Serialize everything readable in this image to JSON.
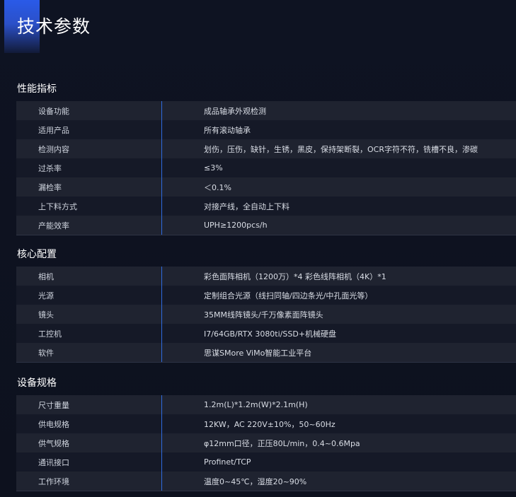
{
  "page_title": "技术参数",
  "sections": [
    {
      "title": "性能指标",
      "rows": [
        {
          "label": "设备功能",
          "value": "成品轴承外观检测"
        },
        {
          "label": "适用产品",
          "value": "所有滚动轴承"
        },
        {
          "label": "检测内容",
          "value": "划伤，压伤，缺针，生锈，黑皮，保持架断裂，OCR字符不符，铣槽不良，渗碳"
        },
        {
          "label": "过杀率",
          "value": "≤3%"
        },
        {
          "label": "漏检率",
          "value": "＜0.1%"
        },
        {
          "label": "上下料方式",
          "value": "对接产线，全自动上下料"
        },
        {
          "label": "产能效率",
          "value": "UPH≥1200pcs/h"
        }
      ]
    },
    {
      "title": "核心配置",
      "rows": [
        {
          "label": "相机",
          "value": "彩色面阵相机（1200万）*4 彩色线阵相机（4K）*1"
        },
        {
          "label": "光源",
          "value": "定制组合光源（线扫同轴/四边条光/中孔面光等）"
        },
        {
          "label": "镜头",
          "value": "35MM线阵镜头/千万像素面阵镜头"
        },
        {
          "label": "工控机",
          "value": "I7/64GB/RTX 3080ti/SSD+机械硬盘"
        },
        {
          "label": "软件",
          "value": "思谋SMore ViMo智能工业平台"
        }
      ]
    },
    {
      "title": "设备规格",
      "rows": [
        {
          "label": "尺寸重量",
          "value": "1.2m(L)*1.2m(W)*2.1m(H)"
        },
        {
          "label": "供电规格",
          "value": "12KW，AC 220V±10%，50~60Hz"
        },
        {
          "label": "供气规格",
          "value": "φ12mm口径，正压80L/min，0.4~0.6Mpa"
        },
        {
          "label": "通讯接口",
          "value": "Profinet/TCP"
        },
        {
          "label": "工作环境",
          "value": "温度0~45℃，湿度20~90%"
        }
      ]
    }
  ],
  "colors": {
    "background": "#0e1220",
    "accent": "#2a5ae8",
    "divider": "#2f6bdf",
    "row_odd": "#1f2330",
    "row_even": "#151927"
  }
}
